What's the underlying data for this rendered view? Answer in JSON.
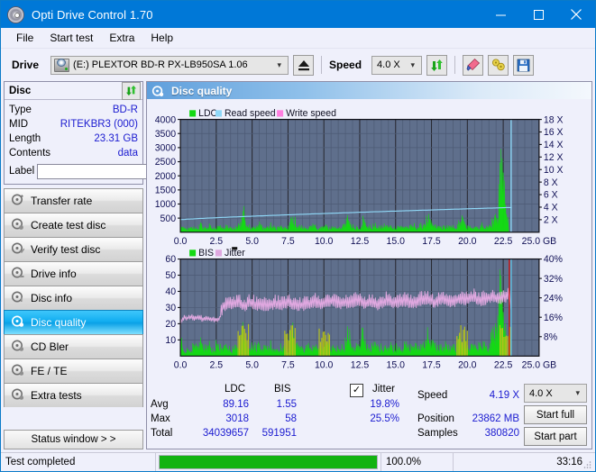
{
  "window": {
    "title": "Opti Drive Control 1.70",
    "icon": "disc-icon",
    "minimize": "minimize-icon",
    "maximize": "maximize-icon",
    "close": "close-icon"
  },
  "menu": [
    "File",
    "Start test",
    "Extra",
    "Help"
  ],
  "toolbar": {
    "drive_label": "Drive",
    "drive_value": "(E:)   PLEXTOR BD-R  PX-LB950SA 1.06",
    "eject": "eject-icon",
    "speed_label": "Speed",
    "speed_value": "4.0 X",
    "refresh": "refresh-icon",
    "eraser": "eraser-icon",
    "tools": "tools-icon",
    "save": "save-icon"
  },
  "disc": {
    "title": "Disc",
    "refresh": "refresh-icon",
    "rows": [
      {
        "key": "Type",
        "value": "BD-R"
      },
      {
        "key": "MID",
        "value": "RITEKBR3 (000)"
      },
      {
        "key": "Length",
        "value": "23.31 GB"
      },
      {
        "key": "Contents",
        "value": "data"
      }
    ],
    "label_key": "Label",
    "label_value": "",
    "disc_button": "cd-icon"
  },
  "nav": {
    "items": [
      {
        "label": "Transfer rate",
        "selected": false
      },
      {
        "label": "Create test disc",
        "selected": false
      },
      {
        "label": "Verify test disc",
        "selected": false
      },
      {
        "label": "Drive info",
        "selected": false
      },
      {
        "label": "Disc info",
        "selected": false
      },
      {
        "label": "Disc quality",
        "selected": true
      },
      {
        "label": "CD Bler",
        "selected": false
      },
      {
        "label": "FE / TE",
        "selected": false
      },
      {
        "label": "Extra tests",
        "selected": false
      }
    ],
    "status_window": "Status window > >"
  },
  "panel": {
    "title": "Disc quality",
    "icon": "disc-quality-icon"
  },
  "stats": {
    "col_ldc": "LDC",
    "col_bis": "BIS",
    "jitter_label": "Jitter",
    "jitter_checked": true,
    "rows": [
      {
        "name": "Avg",
        "ldc": "89.16",
        "bis": "1.55",
        "jitter": "19.8%"
      },
      {
        "name": "Max",
        "ldc": "3018",
        "bis": "58",
        "jitter": "25.5%"
      },
      {
        "name": "Total",
        "ldc": "34039657",
        "bis": "591951",
        "jitter": ""
      }
    ],
    "speed_key": "Speed",
    "speed_val": "4.19 X",
    "position_key": "Position",
    "position_val": "23862 MB",
    "samples_key": "Samples",
    "samples_val": "380820",
    "speed_select": "4.0 X",
    "start_full": "Start full",
    "start_part": "Start part"
  },
  "statusbar": {
    "message": "Test completed",
    "percent_text": "100.0%",
    "percent": 100,
    "elapsed": "33:16"
  },
  "colors": {
    "accent": "#0078d7",
    "plot_bg": "#5f6f8c",
    "ldc": "#14d914",
    "bis": "#14d914",
    "read_speed": "#8fd8f7",
    "write_speed": "#ff7fe0",
    "jitter": "#e0a8e0",
    "progress": "#12b312",
    "value_text": "#1b1bd0"
  },
  "chart_data": [
    {
      "type": "area",
      "title": "LDC",
      "xlabel": "GB",
      "ylabel": "LDC",
      "legend": [
        "LDC",
        "Read speed",
        "Write speed"
      ],
      "legend_position": "top-left",
      "grid": true,
      "xlim": [
        0,
        25
      ],
      "ylim": [
        0,
        4000
      ],
      "xticks": [
        "0.0",
        "2.5",
        "5.0",
        "7.5",
        "10.0",
        "12.5",
        "15.0",
        "17.5",
        "20.0",
        "22.5",
        "25.0 GB"
      ],
      "yticks": [
        500,
        1000,
        1500,
        2000,
        2500,
        3000,
        3500,
        4000
      ],
      "y2label": "X",
      "y2lim": [
        0,
        18
      ],
      "y2ticks": [
        "2 X",
        "4 X",
        "6 X",
        "8 X",
        "10 X",
        "12 X",
        "14 X",
        "16 X",
        "18 X"
      ],
      "series": [
        {
          "name": "LDC",
          "kind": "bars",
          "color": "#14d914",
          "x": [
            0.05,
            0.2,
            0.4,
            0.6,
            0.8,
            1.0,
            1.2,
            1.4,
            1.6,
            1.8,
            2.0,
            2.2,
            2.4,
            2.6,
            2.8,
            3.0,
            3.2,
            3.4,
            3.6,
            3.8,
            4.0,
            4.2,
            4.35,
            4.5,
            4.7,
            4.9,
            5.1,
            5.3,
            5.5,
            5.7,
            5.9,
            6.1,
            6.3,
            6.5,
            6.7,
            6.9,
            7.1,
            7.3,
            7.5,
            7.7,
            7.9,
            8.1,
            8.3,
            8.5,
            8.7,
            8.9,
            9.1,
            9.3,
            9.5,
            9.7,
            9.9,
            10.1,
            10.3,
            10.5,
            10.7,
            10.9,
            11.1,
            11.3,
            11.5,
            11.7,
            11.9,
            12.1,
            12.3,
            12.5,
            12.7,
            12.9,
            13.1,
            13.3,
            13.5,
            13.7,
            13.9,
            14.1,
            14.3,
            14.5,
            14.7,
            14.9,
            15.1,
            15.3,
            15.5,
            15.7,
            15.9,
            16.1,
            16.3,
            16.5,
            16.7,
            16.9,
            17.1,
            17.3,
            17.5,
            17.7,
            17.9,
            18.1,
            18.3,
            18.5,
            18.7,
            18.9,
            19.1,
            19.3,
            19.5,
            19.7,
            19.9,
            20.1,
            20.3,
            20.5,
            20.7,
            20.9,
            21.1,
            21.3,
            21.5,
            21.7,
            21.9,
            22.1,
            22.3,
            22.5,
            22.7,
            22.85,
            22.95,
            23.0,
            23.08,
            23.15
          ],
          "values": [
            290,
            150,
            130,
            140,
            170,
            200,
            160,
            300,
            210,
            180,
            260,
            150,
            170,
            330,
            190,
            160,
            230,
            180,
            150,
            200,
            260,
            480,
            950,
            520,
            330,
            240,
            260,
            200,
            330,
            230,
            180,
            220,
            280,
            200,
            170,
            240,
            190,
            150,
            210,
            480,
            560,
            300,
            240,
            200,
            170,
            230,
            190,
            260,
            200,
            170,
            210,
            250,
            180,
            200,
            230,
            170,
            260,
            200,
            350,
            620,
            290,
            200,
            250,
            190,
            560,
            310,
            240,
            200,
            280,
            230,
            190,
            240,
            300,
            200,
            250,
            190,
            280,
            230,
            200,
            260,
            190,
            230,
            270,
            200,
            240,
            300,
            480,
            520,
            300,
            250,
            200,
            230,
            190,
            260,
            210,
            180,
            240,
            200,
            560,
            480,
            230,
            190,
            260,
            300,
            200,
            250,
            310,
            200,
            240,
            420,
            620,
            760,
            3018,
            2400,
            900,
            260
          ],
          "ymax_label": 4000
        },
        {
          "name": "Read speed",
          "kind": "line",
          "color": "#8fd8f7",
          "x": [
            0.0,
            1.0,
            2.0,
            3.0,
            4.0,
            5.0,
            6.0,
            7.0,
            8.0,
            9.0,
            10.0,
            11.0,
            12.0,
            13.0,
            14.0,
            15.0,
            16.0,
            17.0,
            18.0,
            19.0,
            20.0,
            21.0,
            22.0,
            22.8,
            23.0,
            23.0
          ],
          "values_x_axis": [
            2.0,
            2.1,
            2.3,
            2.4,
            2.5,
            2.6,
            2.75,
            2.85,
            2.95,
            3.05,
            3.15,
            3.25,
            3.3,
            3.4,
            3.45,
            3.5,
            3.55,
            3.6,
            3.65,
            3.7,
            3.75,
            3.8,
            3.85,
            3.9,
            18.0,
            0.0
          ],
          "note": "read speed rises ~2.0X to ~3.9X then a vertical spike to 18X at 23.0 GB"
        },
        {
          "name": "Write speed",
          "kind": "line",
          "color": "#ff7fe0",
          "x": [],
          "values": []
        }
      ]
    },
    {
      "type": "area",
      "title": "BIS",
      "xlabel": "GB",
      "ylabel": "BIS",
      "legend": [
        "BIS",
        "Jitter"
      ],
      "legend_position": "top-left",
      "grid": true,
      "xlim": [
        0,
        25
      ],
      "ylim": [
        0,
        60
      ],
      "xticks": [
        "0.0",
        "2.5",
        "5.0",
        "7.5",
        "10.0",
        "12.5",
        "15.0",
        "17.5",
        "20.0",
        "22.5",
        "25.0 GB"
      ],
      "yticks": [
        10,
        20,
        30,
        40,
        50,
        60
      ],
      "y2label": "%",
      "y2lim": [
        0,
        40
      ],
      "y2ticks": [
        "8%",
        "16%",
        "24%",
        "32%",
        "40%"
      ],
      "series": [
        {
          "name": "BIS",
          "kind": "bars",
          "color": "#14d914",
          "x": [
            0.05,
            0.2,
            0.4,
            0.6,
            0.8,
            1.0,
            1.2,
            1.4,
            1.6,
            1.8,
            2.0,
            2.2,
            2.4,
            2.6,
            2.8,
            3.0,
            3.2,
            3.4,
            3.6,
            3.8,
            4.0,
            4.2,
            4.35,
            4.5,
            4.7,
            4.9,
            5.1,
            5.3,
            5.5,
            5.7,
            5.9,
            6.1,
            6.3,
            6.5,
            6.7,
            6.9,
            7.1,
            7.3,
            7.5,
            7.7,
            7.9,
            8.1,
            8.3,
            8.5,
            8.7,
            8.9,
            9.1,
            9.3,
            9.5,
            9.7,
            9.9,
            10.1,
            10.3,
            10.5,
            10.7,
            10.9,
            11.1,
            11.3,
            11.5,
            11.7,
            11.9,
            12.1,
            12.3,
            12.5,
            12.7,
            12.9,
            13.1,
            13.3,
            13.5,
            13.7,
            13.9,
            14.1,
            14.3,
            14.5,
            14.7,
            14.9,
            15.1,
            15.3,
            15.5,
            15.7,
            15.9,
            16.1,
            16.3,
            16.5,
            16.7,
            16.9,
            17.1,
            17.3,
            17.5,
            17.7,
            17.9,
            18.1,
            18.3,
            18.5,
            18.7,
            18.9,
            19.1,
            19.3,
            19.5,
            19.7,
            19.9,
            20.1,
            20.3,
            20.5,
            20.7,
            20.9,
            21.1,
            21.3,
            21.5,
            21.7,
            21.9,
            22.1,
            22.3,
            22.5,
            22.7,
            22.85,
            22.95,
            23.05,
            23.12
          ],
          "values": [
            12,
            5,
            4,
            5,
            6,
            7,
            5,
            9,
            7,
            6,
            8,
            5,
            6,
            10,
            6,
            5,
            7,
            6,
            5,
            6,
            8,
            14,
            21,
            16,
            10,
            7,
            8,
            6,
            10,
            7,
            6,
            7,
            9,
            6,
            5,
            7,
            6,
            5,
            6,
            15,
            17,
            9,
            7,
            6,
            5,
            7,
            6,
            8,
            6,
            5,
            6,
            8,
            6,
            6,
            7,
            5,
            8,
            6,
            11,
            17,
            9,
            6,
            8,
            6,
            17,
            9,
            7,
            6,
            8,
            7,
            6,
            7,
            9,
            6,
            8,
            6,
            9,
            7,
            6,
            8,
            6,
            7,
            8,
            6,
            7,
            9,
            14,
            16,
            9,
            8,
            6,
            7,
            6,
            8,
            6,
            5,
            7,
            6,
            17,
            14,
            7,
            6,
            8,
            9,
            6,
            8,
            9,
            6,
            7,
            13,
            19,
            22,
            58,
            30,
            12
          ],
          "ymax_label": 60
        },
        {
          "name": "Jitter",
          "kind": "line",
          "color": "#e0a8e0",
          "axis": "right",
          "x": [
            0.05,
            0.3,
            0.6,
            0.9,
            1.2,
            1.5,
            1.8,
            2.1,
            2.4,
            2.7,
            3.0,
            3.3,
            3.6,
            3.9,
            4.2,
            4.5,
            4.8,
            5.1,
            5.4,
            5.7,
            6.0,
            6.3,
            6.6,
            6.9,
            7.2,
            7.5,
            7.8,
            8.1,
            8.4,
            8.7,
            9.0,
            9.3,
            9.6,
            9.9,
            10.2,
            10.5,
            10.8,
            11.1,
            11.4,
            11.7,
            12.0,
            12.3,
            12.6,
            12.9,
            13.2,
            13.5,
            13.8,
            14.1,
            14.4,
            14.7,
            15.0,
            15.3,
            15.6,
            15.9,
            16.2,
            16.5,
            16.8,
            17.1,
            17.4,
            17.7,
            18.0,
            18.3,
            18.6,
            18.9,
            19.2,
            19.5,
            19.8,
            20.1,
            20.4,
            20.7,
            21.0,
            21.3,
            21.6,
            21.9,
            22.2,
            22.5,
            22.8,
            23.0
          ],
          "values": [
            13.3,
            15.0,
            15.3,
            15.0,
            14.7,
            14.7,
            15.0,
            14.7,
            14.3,
            14.3,
            18.7,
            19.7,
            19.3,
            20.3,
            19.7,
            19.0,
            20.3,
            19.7,
            19.0,
            19.3,
            18.7,
            19.3,
            19.7,
            19.0,
            19.7,
            20.3,
            19.7,
            19.0,
            19.3,
            18.7,
            19.7,
            20.3,
            19.7,
            19.3,
            20.3,
            21.0,
            20.3,
            19.7,
            20.3,
            19.7,
            20.3,
            21.0,
            20.3,
            19.7,
            20.3,
            19.7,
            19.3,
            20.3,
            21.0,
            20.3,
            19.7,
            20.3,
            21.0,
            20.3,
            19.7,
            20.3,
            21.0,
            21.7,
            21.0,
            20.3,
            21.0,
            21.7,
            21.0,
            20.3,
            21.0,
            21.7,
            21.0,
            21.7,
            22.3,
            21.7,
            21.0,
            21.7,
            22.3,
            22.3,
            22.0,
            21.7,
            23.0,
            23.0
          ],
          "avg": 19.8,
          "max": 25.5
        }
      ]
    }
  ]
}
